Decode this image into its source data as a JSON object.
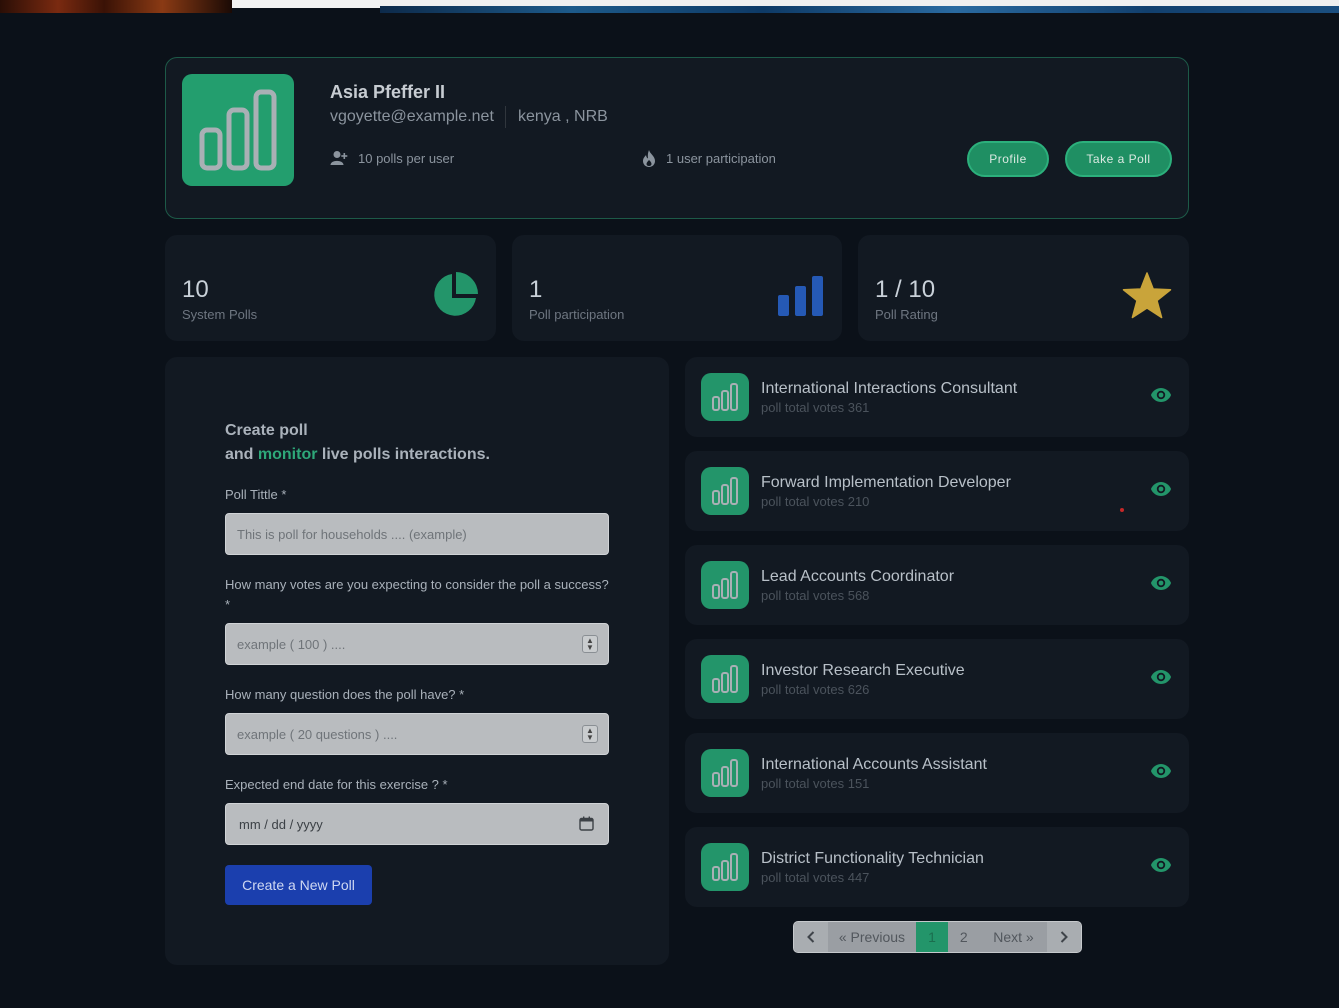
{
  "colors": {
    "background": "#0b1119",
    "card": "#121922",
    "accent_green": "#239e6e",
    "accent_blue": "#1b3fae",
    "star_gold": "#c9a43a"
  },
  "profile": {
    "logo_icon": "bar-chart-icon",
    "name": "Asia Pfeffer II",
    "email": "vgoyette@example.net",
    "location": "kenya , NRB",
    "polls_per_user": "10 polls per user",
    "participation": "1 user participation",
    "profile_button": "Profile",
    "take_poll_button": "Take a Poll"
  },
  "stats": [
    {
      "value": "10",
      "label": "System Polls",
      "icon": "pie-chart-icon"
    },
    {
      "value": "1",
      "label": "Poll participation",
      "icon": "bar-chart-icon"
    },
    {
      "value": "1 / 10",
      "label": "Poll Rating",
      "icon": "star-icon"
    }
  ],
  "form": {
    "heading_line1": "Create poll",
    "heading_and": "and ",
    "heading_highlight": "monitor",
    "heading_rest": " live polls interactions.",
    "title_label": "Poll Tittle *",
    "title_placeholder": "This is poll for households .... (example)",
    "votes_label": "How many votes are you expecting to consider the poll a success? *",
    "votes_placeholder": "example ( 100 ) ....",
    "questions_label": "How many question does the poll have? *",
    "questions_placeholder": "example ( 20  questions ) ....",
    "date_label": "Expected end date for this exercise ? *",
    "date_placeholder": "mm / dd / yyyy",
    "submit_label": "Create a New Poll"
  },
  "polls": [
    {
      "title": "International Interactions Consultant",
      "votes": "poll total votes 361"
    },
    {
      "title": "Forward Implementation Developer",
      "votes": "poll total votes 210"
    },
    {
      "title": "Lead Accounts Coordinator",
      "votes": "poll total votes 568"
    },
    {
      "title": "Investor Research Executive",
      "votes": "poll total votes 626"
    },
    {
      "title": "International Accounts Assistant",
      "votes": "poll total votes 151"
    },
    {
      "title": "District Functionality Technician",
      "votes": "poll total votes 447"
    }
  ],
  "pagination": {
    "previous": "« Previous",
    "pages": [
      "1",
      "2"
    ],
    "current": "1",
    "next": "Next »"
  }
}
